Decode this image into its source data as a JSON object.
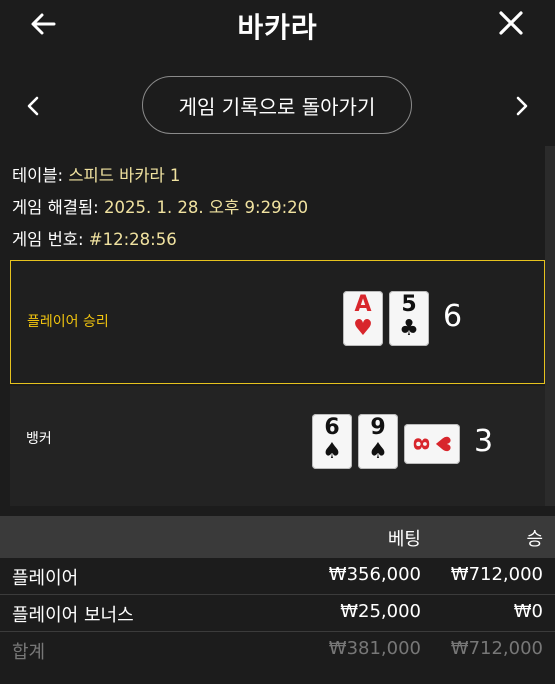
{
  "header": {
    "title": "바카라"
  },
  "nav": {
    "history_button": "게임 기록으로 돌아가기"
  },
  "info": {
    "table_label": "테이블:",
    "table_value": "스피드 바카라 1",
    "resolved_label": "게임 해결됨:",
    "resolved_value": "2025. 1. 28. 오후 9:29:20",
    "number_label": "게임 번호:",
    "number_value": "#12:28:56"
  },
  "player": {
    "outcome": "플레이어 승리",
    "cards": [
      {
        "rank": "A",
        "suit": "♥",
        "color": "red"
      },
      {
        "rank": "5",
        "suit": "♣",
        "color": "black"
      }
    ],
    "total": "6"
  },
  "banker": {
    "outcome": "뱅커",
    "cards": [
      {
        "rank": "6",
        "suit": "♠",
        "color": "black"
      },
      {
        "rank": "9",
        "suit": "♠",
        "color": "black"
      },
      {
        "rank": "8",
        "suit": "♥",
        "color": "red",
        "orientation": "horizontal"
      }
    ],
    "total": "3"
  },
  "bets": {
    "col_bet": "베팅",
    "col_win": "승",
    "rows": [
      {
        "name": "플레이어",
        "bet": "₩356,000",
        "win": "₩712,000"
      },
      {
        "name": "플레이어 보너스",
        "bet": "₩25,000",
        "win": "₩0"
      }
    ],
    "total": {
      "name": "합계",
      "bet": "₩381,000",
      "win": "₩712,000"
    }
  },
  "colors": {
    "accent": "#f1c40f",
    "card_red": "#d8262c",
    "background": "#1c1c1c"
  },
  "icons": {
    "back": "arrow-left-icon",
    "close": "close-icon",
    "prev": "chevron-left-icon",
    "next": "chevron-right-icon"
  }
}
